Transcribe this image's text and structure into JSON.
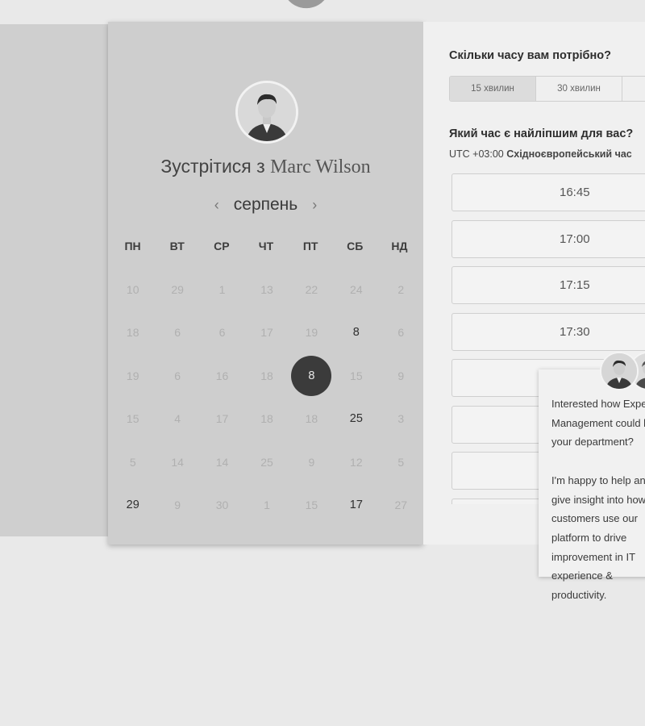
{
  "scheduler": {
    "title_prefix": "Зустрітися з",
    "host_name": "Marc Wilson",
    "month": "серпень",
    "prev_symbol": "‹",
    "next_symbol": "›",
    "weekdays": [
      "ПН",
      "ВТ",
      "СР",
      "ЧТ",
      "ПТ",
      "СБ",
      "НД"
    ],
    "weeks": [
      [
        {
          "d": "10",
          "a": false
        },
        {
          "d": "29",
          "a": false
        },
        {
          "d": "1",
          "a": false
        },
        {
          "d": "13",
          "a": false
        },
        {
          "d": "22",
          "a": false
        },
        {
          "d": "24",
          "a": false
        },
        {
          "d": "2",
          "a": false
        }
      ],
      [
        {
          "d": "18",
          "a": false
        },
        {
          "d": "6",
          "a": false
        },
        {
          "d": "6",
          "a": false
        },
        {
          "d": "17",
          "a": false
        },
        {
          "d": "19",
          "a": false
        },
        {
          "d": "8",
          "a": true
        },
        {
          "d": "6",
          "a": false
        }
      ],
      [
        {
          "d": "19",
          "a": false
        },
        {
          "d": "6",
          "a": false
        },
        {
          "d": "16",
          "a": false
        },
        {
          "d": "18",
          "a": false
        },
        {
          "d": "8",
          "a": true,
          "selected": true
        },
        {
          "d": "15",
          "a": false
        },
        {
          "d": "9",
          "a": false
        }
      ],
      [
        {
          "d": "15",
          "a": false
        },
        {
          "d": "4",
          "a": false
        },
        {
          "d": "17",
          "a": false
        },
        {
          "d": "18",
          "a": false
        },
        {
          "d": "18",
          "a": false
        },
        {
          "d": "25",
          "a": true
        },
        {
          "d": "3",
          "a": false
        }
      ],
      [
        {
          "d": "5",
          "a": false
        },
        {
          "d": "14",
          "a": false
        },
        {
          "d": "14",
          "a": false
        },
        {
          "d": "25",
          "a": false
        },
        {
          "d": "9",
          "a": false
        },
        {
          "d": "12",
          "a": false
        },
        {
          "d": "5",
          "a": false
        }
      ],
      [
        {
          "d": "29",
          "a": true
        },
        {
          "d": "9",
          "a": false
        },
        {
          "d": "30",
          "a": false
        },
        {
          "d": "1",
          "a": false
        },
        {
          "d": "15",
          "a": false
        },
        {
          "d": "17",
          "a": true
        },
        {
          "d": "27",
          "a": false
        }
      ]
    ]
  },
  "booking": {
    "duration_question": "Скільки часу вам потрібно?",
    "durations": [
      "15 хвилин",
      "30 хвилин",
      ""
    ],
    "time_question": "Який час є найліпшим для вас?",
    "tz_offset": "UTC +03:00",
    "tz_name": "Східноєвропейський час",
    "slots": [
      "16:45",
      "17:00",
      "17:15",
      "17:30",
      "",
      "",
      "",
      ""
    ]
  },
  "chat": {
    "message": "Interested how Expert Management could help your department?\n\nI'm happy to help and give insight into how our customers use our platform to drive improvement in IT experience & productivity."
  }
}
